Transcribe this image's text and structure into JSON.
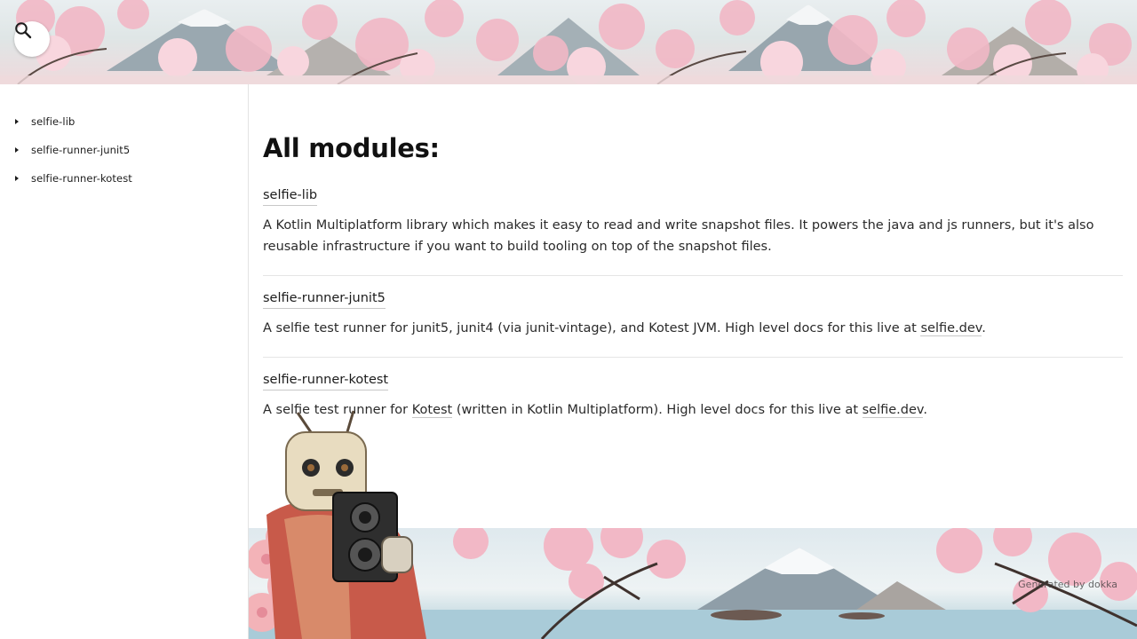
{
  "search": {
    "icon": "search-icon"
  },
  "sidebar": {
    "items": [
      {
        "label": "selfie-lib"
      },
      {
        "label": "selfie-runner-junit5"
      },
      {
        "label": "selfie-runner-kotest"
      }
    ]
  },
  "main": {
    "title": "All modules:",
    "modules": [
      {
        "name": "selfie-lib",
        "description": "A Kotlin Multiplatform library which makes it easy to read and write snapshot files. It powers the java and js runners, but it's also reusable infrastructure if you want to build tooling on top of the snapshot files."
      },
      {
        "name": "selfie-runner-junit5",
        "description_prefix": "A selfie test runner for junit5, junit4 (via junit-vintage), and Kotest JVM. High level docs for this live at ",
        "link": "selfie.dev",
        "description_suffix": "."
      },
      {
        "name": "selfie-runner-kotest",
        "description_prefix": "A selfie test runner for ",
        "link1": "Kotest",
        "description_middle": " (written in Kotlin Multiplatform). High level docs for this live at ",
        "link2": "selfie.dev",
        "description_suffix": "."
      }
    ]
  },
  "footer": {
    "generated": "Generated by dokka"
  },
  "colors": {
    "text": "#1c1c1c",
    "border": "#e3e3e3",
    "blossom": "#f2b8c6"
  }
}
